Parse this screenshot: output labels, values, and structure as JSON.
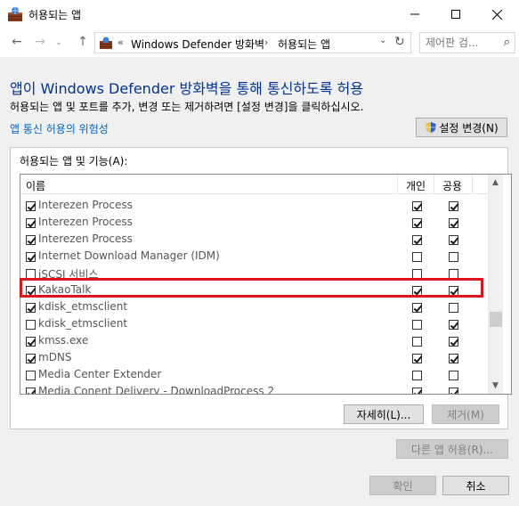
{
  "window": {
    "title": "허용되는 앱",
    "minimize_icon": "minimize-icon",
    "maximize_icon": "maximize-icon",
    "close_icon": "close-icon"
  },
  "address_bar": {
    "overflow": "«",
    "crumbs": [
      "Windows Defender 방화벽",
      "허용되는 앱"
    ],
    "separator": "›",
    "search_placeholder": "제어판 검..."
  },
  "content": {
    "heading": "앱이 Windows Defender 방화벽을 통해 통신하도록 허용",
    "description": "허용되는 앱 및 포트를 추가, 변경 또는 제거하려면 [설정 변경]을 클릭하십시오.",
    "risk_link": "앱 통신 허용의 위험성",
    "change_settings": "설정 변경(N)",
    "group_label": "허용되는 앱 및 기능(A):",
    "columns": {
      "name": "이름",
      "private": "개인",
      "public": "공용"
    },
    "rows": [
      {
        "name": "Interezen Process",
        "enabled": true,
        "private": true,
        "public": true
      },
      {
        "name": "Interezen Process",
        "enabled": true,
        "private": true,
        "public": true
      },
      {
        "name": "Interezen Process",
        "enabled": true,
        "private": true,
        "public": true
      },
      {
        "name": "Internet Download Manager (IDM)",
        "enabled": true,
        "private": false,
        "public": false
      },
      {
        "name": "iSCSI 서비스",
        "enabled": false,
        "private": false,
        "public": false
      },
      {
        "name": "KakaoTalk",
        "enabled": true,
        "private": true,
        "public": true
      },
      {
        "name": "kdisk_etmsclient",
        "enabled": true,
        "private": true,
        "public": false
      },
      {
        "name": "kdisk_etmsclient",
        "enabled": false,
        "private": false,
        "public": true
      },
      {
        "name": "kmss.exe",
        "enabled": true,
        "private": false,
        "public": true
      },
      {
        "name": "mDNS",
        "enabled": true,
        "private": true,
        "public": true
      },
      {
        "name": "Media Center Extender",
        "enabled": false,
        "private": false,
        "public": false
      },
      {
        "name": "Media Conent Delivery - DownloadProcess 2",
        "enabled": true,
        "private": true,
        "public": true
      }
    ],
    "details_button": "자세히(L)...",
    "remove_button": "제거(M)",
    "allow_other_button": "다른 앱 허용(R)...",
    "ok_button": "확인",
    "cancel_button": "취소"
  },
  "colors": {
    "heading": "#003399",
    "link": "#0066cc",
    "highlight": "#e0141e"
  }
}
